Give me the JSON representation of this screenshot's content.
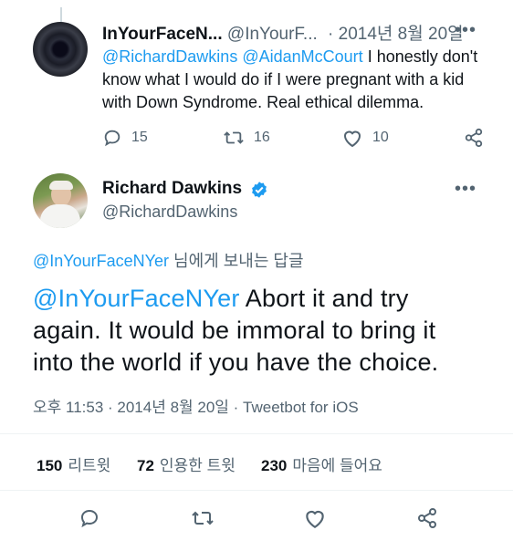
{
  "reply_tweet": {
    "display_name": "InYourFaceN...",
    "handle": "@InYourF...",
    "date": "· 2014년 8월 20일",
    "more": "•••",
    "mention1": "@RichardDawkins",
    "mention2": "@AidanMcCourt",
    "text": "I honestly don't know what I would do if I were pregnant with a kid with Down Syndrome. Real ethical dilemma.",
    "replies": "15",
    "retweets": "16",
    "likes": "10"
  },
  "main_tweet": {
    "display_name": "Richard Dawkins",
    "handle": "@RichardDawkins",
    "more": "•••",
    "replying_to_handle": "@InYourFaceNYer",
    "replying_to_suffix": "님에게 보내는 답글",
    "mention": "@InYourFaceNYer",
    "text": "Abort it and try again. It would be immoral to bring it into the world if you have the choice.",
    "timestamp": "오후 11:53 · 2014년 8월 20일 · ",
    "client": "Tweetbot for iOS",
    "stats": {
      "retweets_count": "150",
      "retweets_label": "리트윗",
      "quotes_count": "72",
      "quotes_label": "인용한 트윗",
      "likes_count": "230",
      "likes_label": "마음에 들어요"
    }
  },
  "colors": {
    "accent": "#1d9bf0",
    "text": "#0f1419",
    "muted": "#536471",
    "divider": "#eff3f4"
  }
}
